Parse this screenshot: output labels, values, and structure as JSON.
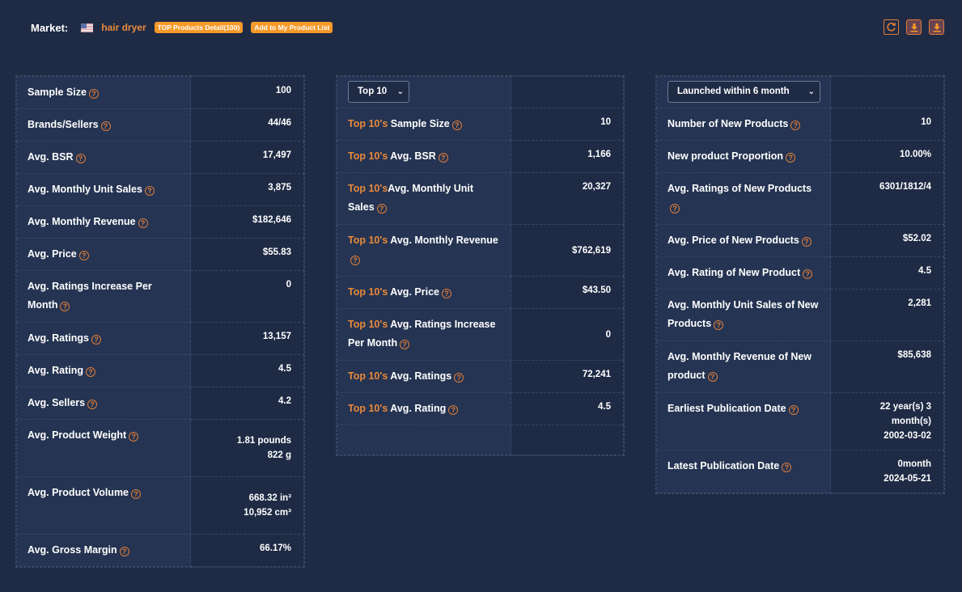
{
  "header": {
    "market_label": "Market:",
    "country_flag": "us-flag-icon",
    "keyword": "hair dryer",
    "top_products_button": "TOP Products Detail(100)",
    "add_to_list_button": "Add to My Product List"
  },
  "actions": {
    "refresh": "refresh-icon",
    "download1": "download-icon",
    "download2": "download-icon"
  },
  "colors": {
    "accent": "#e88a3c",
    "background": "#1f2b45",
    "label_bg": "#253452"
  },
  "overall": {
    "rows": [
      {
        "label": "Sample Size",
        "value": "100"
      },
      {
        "label": "Brands/Sellers",
        "value": "44/46"
      },
      {
        "label": "Avg. BSR",
        "value": "17,497"
      },
      {
        "label": "Avg. Monthly Unit Sales",
        "value": "3,875"
      },
      {
        "label": "Avg. Monthly Revenue",
        "value": "$182,646"
      },
      {
        "label": "Avg. Price",
        "value": "$55.83"
      },
      {
        "label": "Avg. Ratings Increase Per Month",
        "value": "0"
      },
      {
        "label": "Avg. Ratings",
        "value": "13,157"
      },
      {
        "label": "Avg. Rating",
        "value": "4.5"
      },
      {
        "label": "Avg. Sellers",
        "value": "4.2"
      },
      {
        "label": "Avg. Product Weight",
        "value": "1.81 pounds",
        "value2": "822 g"
      },
      {
        "label": "Avg. Product Volume",
        "value": "668.32 in³",
        "value2": "10,952 cm³"
      },
      {
        "label": "Avg. Gross Margin",
        "value": "66.17%"
      }
    ]
  },
  "top": {
    "select_value": "Top 10",
    "prefix": "Top 10's",
    "rows": [
      {
        "label": "Sample Size",
        "value": "10"
      },
      {
        "label": "Avg. BSR",
        "value": "1,166"
      },
      {
        "label": "Avg. Monthly Unit Sales",
        "value": "20,327"
      },
      {
        "label": "Avg. Monthly Revenue",
        "value": "$762,619"
      },
      {
        "label": "Avg. Price",
        "value": "$43.50"
      },
      {
        "label": "Avg. Ratings Increase Per Month",
        "value": "0"
      },
      {
        "label": "Avg. Ratings",
        "value": "72,241"
      },
      {
        "label": "Avg. Rating",
        "value": "4.5"
      }
    ]
  },
  "new": {
    "select_value": "Launched within 6 month",
    "rows": [
      {
        "label": "Number of New Products",
        "value": "10"
      },
      {
        "label": "New product Proportion",
        "value": "10.00%"
      },
      {
        "label": "Avg. Ratings of New Products",
        "value": "6301/1812/4"
      },
      {
        "label": "Avg. Price of New Products",
        "value": "$52.02"
      },
      {
        "label": "Avg. Rating of New Product",
        "value": "4.5"
      },
      {
        "label": "Avg. Monthly Unit Sales of New Products",
        "value": "2,281"
      },
      {
        "label": "Avg. Monthly Revenue of New product",
        "value": "$85,638"
      },
      {
        "label": "Earliest Publication Date",
        "value": "22 year(s) 3 month(s)",
        "value2": "2002-03-02"
      },
      {
        "label": "Latest Publication Date",
        "value": "0month",
        "value2": "2024-05-21"
      }
    ]
  }
}
